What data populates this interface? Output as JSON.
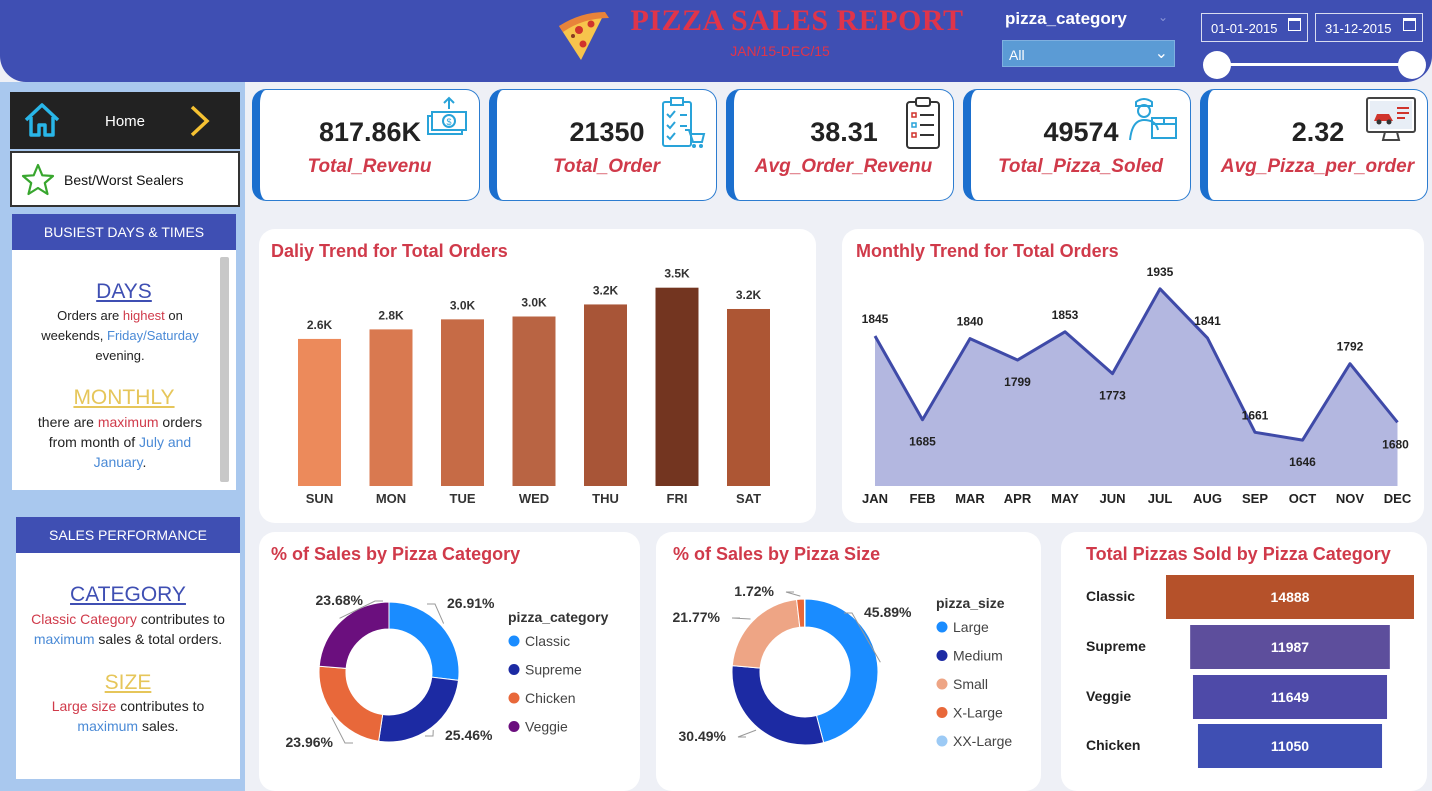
{
  "header": {
    "title": "PIZZA SALES REPORT",
    "subtitle": "JAN/15-DEC/15",
    "slicer_label": "pizza_category",
    "slicer_value": "All",
    "date_start": "01-01-2015",
    "date_end": "31-12-2015"
  },
  "nav": {
    "home": "Home",
    "best_worst": "Best/Worst Sealers"
  },
  "busiest": {
    "heading": "BUSIEST DAYS & TIMES",
    "days_title": "DAYS",
    "days_l1_a": "Orders are ",
    "days_l1_b": "highest",
    "days_l1_c": " on",
    "days_l2_a": "weekends, ",
    "days_l2_b": "Friday/Saturday",
    "days_l3": "evening.",
    "monthly_title": "MONTHLY",
    "monthly_l1_a": "there are ",
    "monthly_l1_b": "maximum",
    "monthly_l1_c": " orders",
    "monthly_l2_a": "from month of ",
    "monthly_l2_b": "July and",
    "monthly_l3_a": "January",
    "monthly_l3_b": "."
  },
  "performance": {
    "heading": "SALES PERFORMANCE",
    "category_title": "CATEGORY",
    "cat_l1_a": "Classic Category",
    "cat_l1_b": " contributes to",
    "cat_l2_a": "maximum",
    "cat_l2_b": " sales & total orders.",
    "size_title": "SIZE",
    "size_l1_a": "Large size",
    "size_l1_b": " contributes to",
    "size_l2_a": "maximum",
    "size_l2_b": " sales."
  },
  "kpis": [
    {
      "value": "817.86K",
      "label": "Total_Revenu",
      "icon": "money-icon"
    },
    {
      "value": "21350",
      "label": "Total_Order",
      "icon": "checklist-cart-icon"
    },
    {
      "value": "38.31",
      "label": "Avg_Order_Revenu",
      "icon": "clipboard-icon"
    },
    {
      "value": "49574",
      "label": "Total_Pizza_Soled",
      "icon": "delivery-man-icon"
    },
    {
      "value": "2.32",
      "label": "Avg_Pizza_per_order",
      "icon": "monitor-car-icon"
    }
  ],
  "colors": {
    "header": "#3f4fb3",
    "accent_red": "#d03a4a",
    "area_fill": "#b3b7e0",
    "area_line": "#3f4aa8"
  },
  "chart_data": [
    {
      "type": "bar",
      "title": "Daliy Trend for Total Orders",
      "categories": [
        "SUN",
        "MON",
        "TUE",
        "WED",
        "THU",
        "FRI",
        "SAT"
      ],
      "values": [
        2624,
        2794,
        2973,
        3024,
        3239,
        3538,
        3158
      ],
      "labels": [
        "2.6K",
        "2.8K",
        "3.0K",
        "3.0K",
        "3.2K",
        "3.5K",
        "3.2K"
      ],
      "colors": [
        "#ec8a5b",
        "#d97950",
        "#c66b46",
        "#b96443",
        "#a85537",
        "#733520",
        "#ad5634"
      ],
      "ylim": [
        0,
        3800
      ]
    },
    {
      "type": "area",
      "title": "Monthly Trend for Total Orders",
      "categories": [
        "JAN",
        "FEB",
        "MAR",
        "APR",
        "MAY",
        "JUN",
        "JUL",
        "AUG",
        "SEP",
        "OCT",
        "NOV",
        "DEC"
      ],
      "values": [
        1845,
        1685,
        1840,
        1799,
        1853,
        1773,
        1935,
        1841,
        1661,
        1646,
        1792,
        1680
      ],
      "ylim": [
        1610,
        1950
      ]
    },
    {
      "type": "pie",
      "title": "% of Sales by Pizza Category",
      "legend_title": "pizza_category",
      "categories": [
        "Classic",
        "Supreme",
        "Chicken",
        "Veggie"
      ],
      "values": [
        26.91,
        25.46,
        23.96,
        23.68
      ],
      "labels": [
        "26.91%",
        "25.46%",
        "23.96%",
        "23.68%"
      ],
      "colors": [
        "#1a8cff",
        "#1c2aa3",
        "#e8683a",
        "#6b0f7e"
      ]
    },
    {
      "type": "pie",
      "title": "% of Sales by Pizza Size",
      "legend_title": "pizza_size",
      "categories": [
        "Large",
        "Medium",
        "Small",
        "X-Large",
        "XX-Large"
      ],
      "values": [
        45.89,
        30.49,
        21.77,
        1.72,
        0.12
      ],
      "labels": [
        "45.89%",
        "30.49%",
        "21.77%",
        "1.72%",
        ""
      ],
      "colors": [
        "#1a8cff",
        "#1c2aa3",
        "#eea585",
        "#e8683a",
        "#9ccaf5"
      ]
    },
    {
      "type": "bar",
      "orientation": "horizontal",
      "title": "Total Pizzas Sold by Pizza Category",
      "categories": [
        "Classic",
        "Supreme",
        "Veggie",
        "Chicken"
      ],
      "values": [
        14888,
        11987,
        11649,
        11050
      ],
      "colors": [
        "#b5512a",
        "#5d4e9c",
        "#4e4aa8",
        "#3f4fb3"
      ]
    }
  ]
}
